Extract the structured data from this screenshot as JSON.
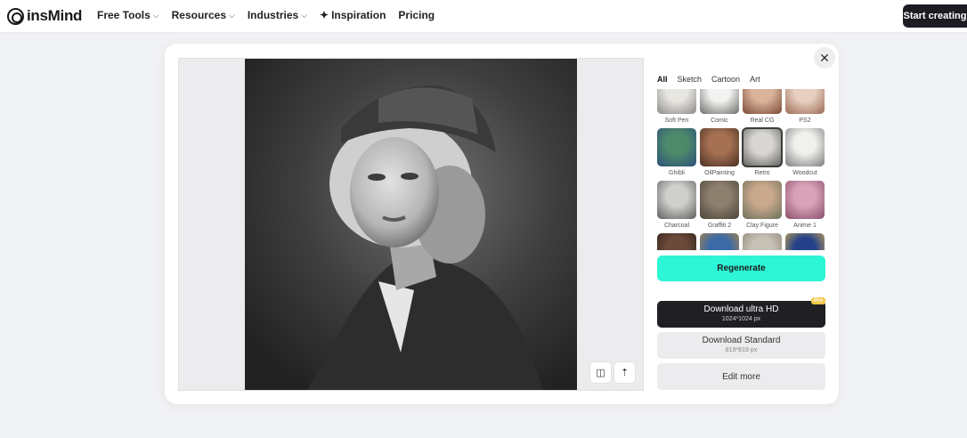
{
  "header": {
    "logo_text": "insMind",
    "nav": [
      {
        "label": "Free Tools",
        "has_chevron": true
      },
      {
        "label": "Resources",
        "has_chevron": true
      },
      {
        "label": "Industries",
        "has_chevron": true
      },
      {
        "label": "Inspiration",
        "icon": "sparkle-icon"
      },
      {
        "label": "Pricing"
      }
    ],
    "cta_label": "Start creating"
  },
  "modal": {
    "close_icon": "close-icon",
    "preview": {
      "tools": [
        {
          "icon": "compare-icon",
          "glyph": "◫"
        },
        {
          "icon": "share-icon",
          "glyph": "⇡"
        }
      ]
    },
    "tabs": [
      {
        "label": "All",
        "active": true
      },
      {
        "label": "Sketch"
      },
      {
        "label": "Cartoon"
      },
      {
        "label": "Art"
      }
    ],
    "styles": [
      {
        "label": "Soft Pen",
        "colors": [
          "#e8e6e1",
          "#8c8a86"
        ]
      },
      {
        "label": "Comic",
        "colors": [
          "#f2f2f0",
          "#6d6d6b"
        ]
      },
      {
        "label": "Real CG",
        "colors": [
          "#d9b39a",
          "#7a4a35"
        ]
      },
      {
        "label": "PS2",
        "colors": [
          "#e8cfc0",
          "#9a6a52"
        ]
      },
      {
        "label": "Ghibli",
        "colors": [
          "#4d8a6a",
          "#2c4f7a"
        ]
      },
      {
        "label": "OilPainting",
        "colors": [
          "#a57152",
          "#4b2f22"
        ]
      },
      {
        "label": "Retro",
        "colors": [
          "#d8d6d2",
          "#5c5a57"
        ],
        "selected": true
      },
      {
        "label": "Woodcut",
        "colors": [
          "#f0f0ee",
          "#7c7c7a"
        ]
      },
      {
        "label": "Charcoal",
        "colors": [
          "#cfcfcd",
          "#5e5e5c"
        ]
      },
      {
        "label": "Graffiti 2",
        "colors": [
          "#8c7f6e",
          "#4c4238"
        ]
      },
      {
        "label": "Clay Figure",
        "colors": [
          "#c9a88c",
          "#6a6f5a"
        ]
      },
      {
        "label": "Anime 1",
        "colors": [
          "#d8a2b8",
          "#8a4f6a"
        ]
      },
      {
        "label": "",
        "colors": [
          "#6b4a3a",
          "#2a1d18"
        ]
      },
      {
        "label": "",
        "colors": [
          "#3a6aa8",
          "#c08a3a"
        ]
      },
      {
        "label": "",
        "colors": [
          "#c7c1b6",
          "#8d8273"
        ]
      },
      {
        "label": "",
        "colors": [
          "#25418a",
          "#e0b84a"
        ]
      }
    ],
    "regenerate_label": "Regenerate",
    "download_ultra": {
      "label": "Download ultra HD",
      "size": "1024*1024 px",
      "badge": "Pro"
    },
    "download_standard": {
      "label": "Download Standard",
      "size": "819*819 px"
    },
    "edit_more_label": "Edit more"
  },
  "colors": {
    "accent": "#2cf6d6",
    "dark": "#1f1f24",
    "pro_badge": "#f3c948"
  }
}
